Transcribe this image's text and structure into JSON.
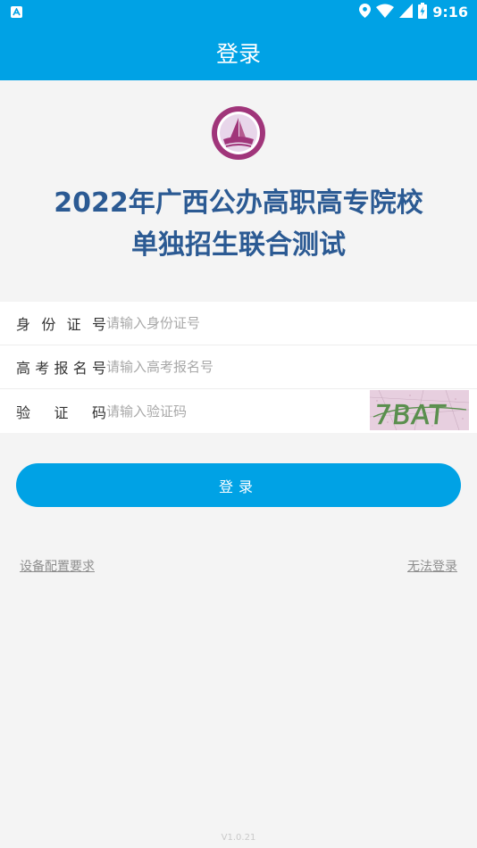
{
  "status_bar": {
    "time": "9:16",
    "icons": [
      "notification-icon",
      "location-icon",
      "wifi-icon",
      "signal-icon",
      "battery-icon"
    ]
  },
  "app_bar": {
    "title": "登录"
  },
  "headline": {
    "line1": "2022年广西公办高职高专院校",
    "line2": "单独招生联合测试"
  },
  "form": {
    "id_label": [
      "身",
      "份",
      "证",
      "号"
    ],
    "id_placeholder": "请输入身份证号",
    "exam_label": [
      "高",
      "考",
      "报",
      "名",
      "号"
    ],
    "exam_placeholder": "请输入高考报名号",
    "captcha_label": [
      "验",
      "证",
      "码"
    ],
    "captcha_placeholder": "请输入验证码",
    "captcha_text": "7BAT"
  },
  "login_button": "登录",
  "links": {
    "device_requirements": "设备配置要求",
    "cannot_login": "无法登录"
  },
  "version": "V1.0.21",
  "colors": {
    "primary": "#00a2e5",
    "headline": "#2b5a93",
    "background": "#f4f4f4"
  }
}
